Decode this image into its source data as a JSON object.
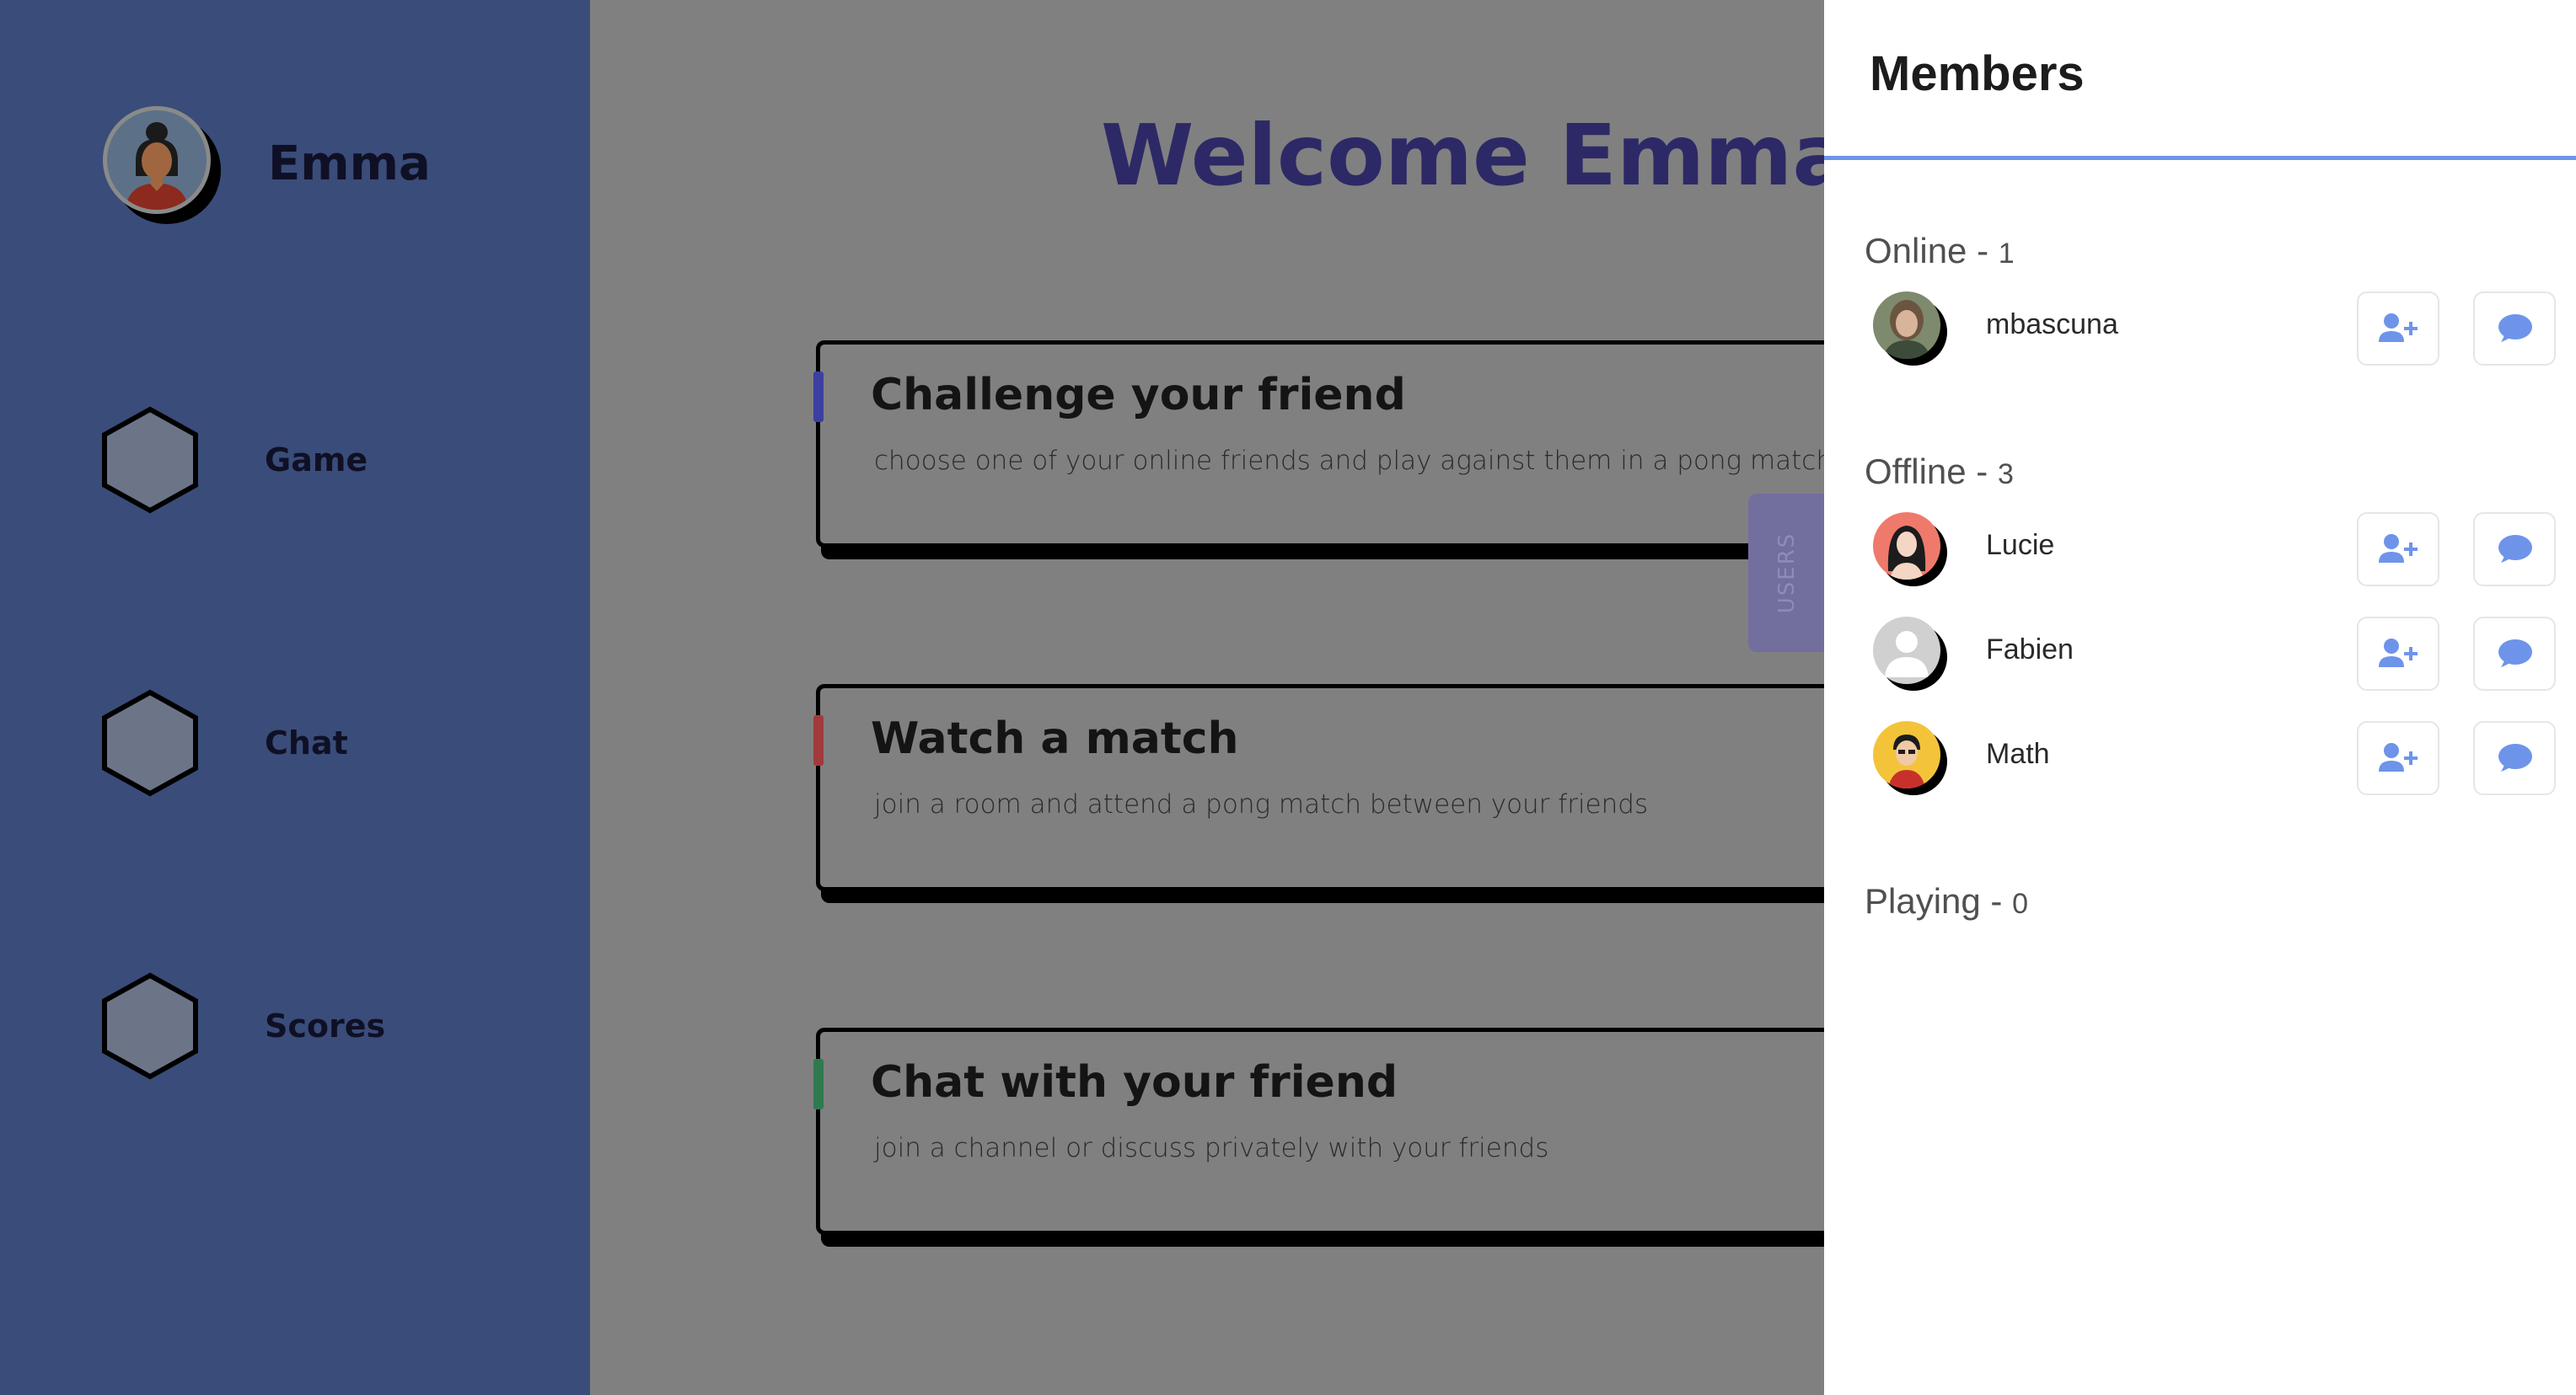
{
  "sidebar": {
    "user_name": "Emma",
    "nav": [
      {
        "label": "Game"
      },
      {
        "label": "Chat"
      },
      {
        "label": "Scores"
      }
    ]
  },
  "main": {
    "welcome": "Welcome Emma",
    "cards": [
      {
        "title": "Challenge your friend",
        "description": "choose one of your online friends and play against them in a pong match",
        "accent": "#3b3fa0"
      },
      {
        "title": "Watch a match",
        "description": "join a room and attend a pong match between your friends",
        "accent": "#a23a3d"
      },
      {
        "title": "Chat with your friend",
        "description": "join a channel or discuss privately with your friends",
        "accent": "#2f7a4f"
      }
    ],
    "users_tab": "USERS"
  },
  "members": {
    "title": "Members",
    "online": {
      "label": "Online - ",
      "count": "1",
      "users": [
        {
          "name": "mbascuna"
        }
      ]
    },
    "offline": {
      "label": "Offline - ",
      "count": "3",
      "users": [
        {
          "name": "Lucie"
        },
        {
          "name": "Fabien"
        },
        {
          "name": "Math"
        }
      ]
    },
    "playing": {
      "label": "Playing - ",
      "count": "0"
    },
    "actions": {
      "add_icon": "user-plus-icon",
      "message_icon": "chat-bubble-icon"
    }
  },
  "colors": {
    "sidebar_bg": "#3a4c79",
    "overlay_bg": "#808080",
    "welcome_text": "#2d2966",
    "panel_accent": "#6e94ea",
    "icon_blue": "#6e94ea"
  }
}
